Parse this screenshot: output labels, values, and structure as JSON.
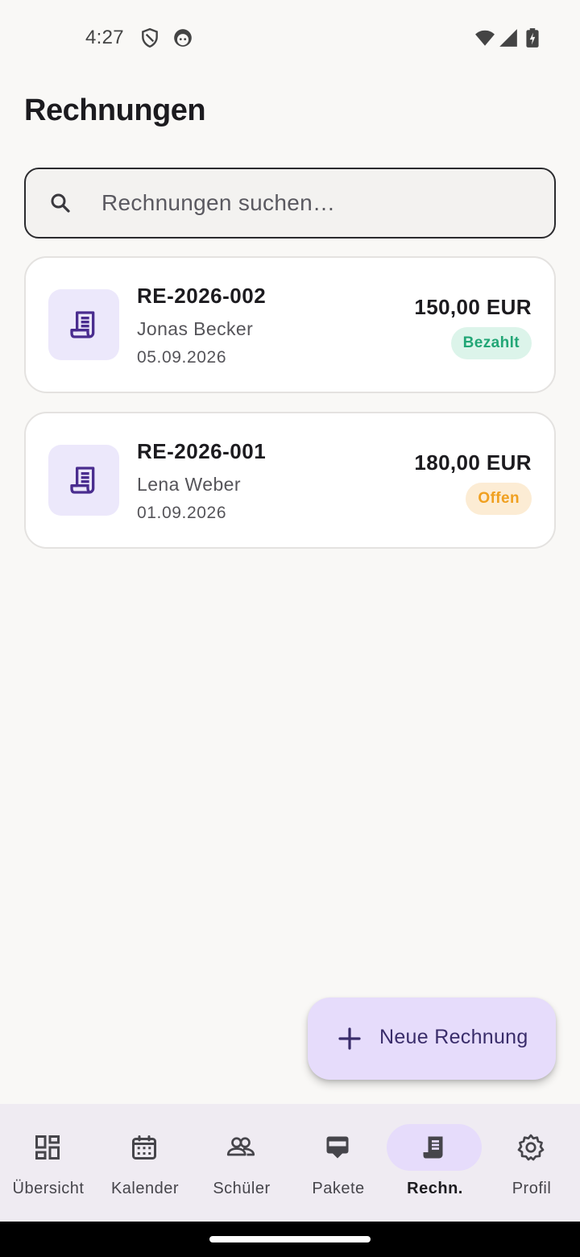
{
  "status_bar": {
    "time": "4:27",
    "icons": [
      "shield-icon",
      "face-icon",
      "wifi-icon",
      "signal-icon",
      "battery-charging-icon"
    ]
  },
  "page": {
    "title": "Rechnungen"
  },
  "search": {
    "placeholder": "Rechnungen suchen…",
    "value": ""
  },
  "invoices": [
    {
      "number": "RE-2026-002",
      "name": "Jonas Becker",
      "date": "05.09.2026",
      "amount": "150,00 EUR",
      "status": "Bezahlt",
      "status_color": "#22a676"
    },
    {
      "number": "RE-2026-001",
      "name": "Lena Weber",
      "date": "01.09.2026",
      "amount": "180,00 EUR",
      "status": "Offen",
      "status_color": "#f0a020"
    }
  ],
  "fab": {
    "label": "Neue Rechnung"
  },
  "nav": {
    "items": [
      {
        "label": "Übersicht",
        "icon": "dashboard-icon"
      },
      {
        "label": "Kalender",
        "icon": "calendar-icon"
      },
      {
        "label": "Schüler",
        "icon": "people-icon"
      },
      {
        "label": "Pakete",
        "icon": "package-icon"
      },
      {
        "label": "Rechn.",
        "icon": "receipt-icon",
        "active": true
      },
      {
        "label": "Profil",
        "icon": "gear-icon"
      }
    ]
  },
  "colors": {
    "accent": "#e6dcfb",
    "icon_purple": "#4a2d8f",
    "background": "#f9f8f6"
  }
}
